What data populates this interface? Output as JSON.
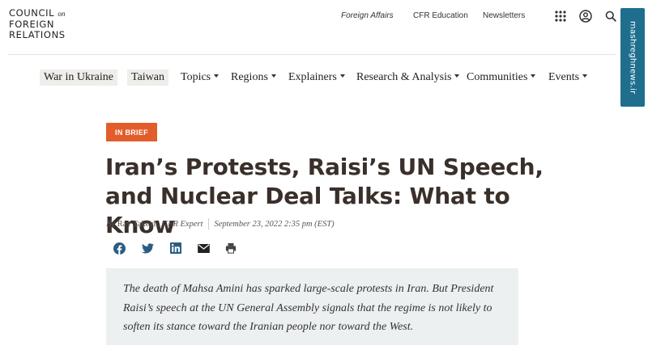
{
  "logo": {
    "line1": "COUNCIL",
    "on": "on",
    "line2": "FOREIGN",
    "line3": "RELATIONS"
  },
  "utility_nav": {
    "links": [
      "Foreign Affairs",
      "CFR Education",
      "Newsletters"
    ],
    "icons": [
      "apps-grid-icon",
      "account-icon",
      "search-icon"
    ]
  },
  "watermark": {
    "text": "mashreghnews.ir"
  },
  "main_nav": {
    "items": [
      {
        "label": "War in Ukraine",
        "dropdown": false
      },
      {
        "label": "Taiwan",
        "dropdown": false
      },
      {
        "label": "Topics",
        "dropdown": true
      },
      {
        "label": "Regions",
        "dropdown": true
      },
      {
        "label": "Explainers",
        "dropdown": true
      },
      {
        "label": "Research & Analysis",
        "dropdown": true
      },
      {
        "label": "Communities",
        "dropdown": true
      },
      {
        "label": "Events",
        "dropdown": true
      }
    ]
  },
  "article": {
    "badge": "IN BRIEF",
    "title": "Iran’s Protests, Raisi’s UN Speech, and Nuclear Deal Talks: What to Know",
    "byline": {
      "prefix": "By",
      "author": "Ray Takeyh",
      "role": ", CFR Expert",
      "date": "September 23, 2022 2:35 pm (EST)"
    },
    "share_icons": [
      "facebook-icon",
      "twitter-icon",
      "linkedin-icon",
      "email-icon",
      "print-icon"
    ],
    "summary": "The death of Mahsa Amini has sparked large-scale protests in Iran. But President Raisi’s speech at the UN General Assembly signals that the regime is not likely to soften its stance toward the Iranian people nor toward the West."
  },
  "colors": {
    "badge": "#e35d2b",
    "title": "#3a2f2a",
    "summary_bg": "#edf0f0",
    "nav_pill_bg": "#efeeea",
    "share_icon": "#2a5d84"
  }
}
